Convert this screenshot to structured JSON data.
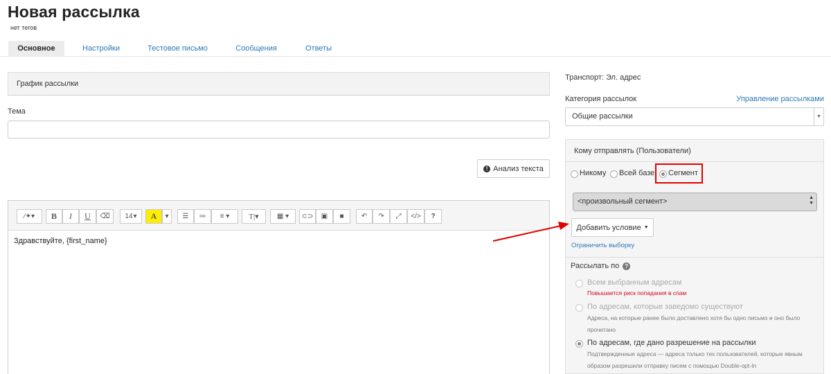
{
  "page": {
    "title": "Новая рассылка",
    "subtitle": "нет тегов"
  },
  "tabs": [
    {
      "label": "Основное",
      "active": true
    },
    {
      "label": "Настройки",
      "active": false
    },
    {
      "label": "Тестовое письмо",
      "active": false
    },
    {
      "label": "Сообщения",
      "active": false
    },
    {
      "label": "Ответы",
      "active": false
    }
  ],
  "schedule": {
    "label": "График рассылки"
  },
  "subject": {
    "label": "Тема",
    "value": "",
    "placeholder": ""
  },
  "analyze_button": {
    "label": "Анализ текста",
    "icon": "exclamation-circle-icon"
  },
  "editor": {
    "toolbar": {
      "font_size": "14",
      "highlight_color": "#ffee00",
      "font_letter": "A",
      "bold": "B",
      "italic": "I",
      "underline": "U",
      "text_style": "T",
      "help": "?"
    },
    "content": "Здравствуйте, {first_name}"
  },
  "transport": {
    "label": "Транспорт: Эл. адрес"
  },
  "category": {
    "label": "Категория рассылок",
    "manage_link": "Управление рассылками",
    "selected": "Общие рассылки"
  },
  "recipients": {
    "title": "Кому отправлять (Пользователи)",
    "options": [
      {
        "label": "Никому",
        "selected": false
      },
      {
        "label": "Всей базе",
        "selected": false
      },
      {
        "label": "Сегмент",
        "selected": true
      }
    ],
    "segment_selected": "<произвольный сегмент>",
    "add_condition_label": "Добавить условие",
    "limit_link": "Ограничить выборку"
  },
  "send_by": {
    "label": "Рассылать по",
    "options": [
      {
        "label": "Всем выбранным адресам",
        "note": "Повышается риск попадания в спам",
        "selected": false,
        "enabled": false
      },
      {
        "label": "По адресам, которые заведомо существуют",
        "note": "Адреса, на которые ранее было доставлено хотя бы одно письмо и оно было прочитано",
        "selected": false,
        "enabled": false
      },
      {
        "label": "По адресам, где дано разрешение на рассылки",
        "note": "Подтвержденные адреса — адреса только тех пользователей, которые явным образом разрешили отправку писем с помощью Double-opt-In",
        "selected": true,
        "enabled": true
      }
    ]
  },
  "annotation": {
    "highlight_color": "#e00000",
    "arrow_color": "#e00000"
  },
  "colors": {
    "link": "#2a7ab8",
    "warning": "#d0021b"
  }
}
